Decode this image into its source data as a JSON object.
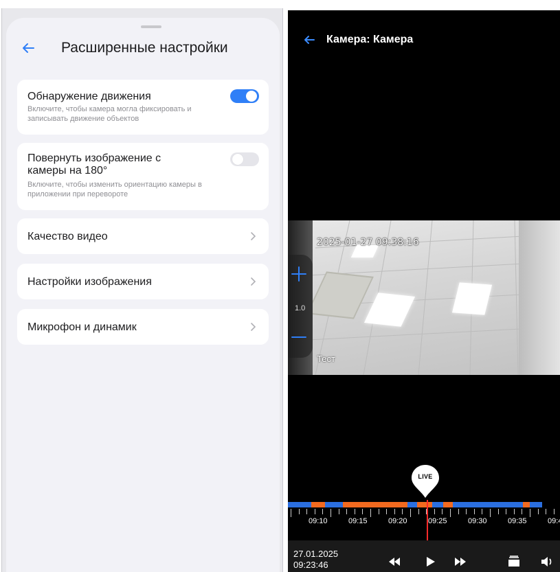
{
  "left": {
    "title": "Расширенные настройки",
    "cards": [
      {
        "title": "Обнаружение движения",
        "desc": "Включите, чтобы камера могла фиксировать и записывать движение объектов",
        "toggle": "on"
      },
      {
        "title": "Повернуть изображение с камеры на 180°",
        "desc": "Включите, чтобы изменить ориентацию камеры в приложении при перевороте",
        "toggle": "off"
      },
      {
        "title": "Качество видео"
      },
      {
        "title": "Настройки изображения"
      },
      {
        "title": "Микрофон и динамик"
      }
    ]
  },
  "right": {
    "title": "Камера: Камера",
    "video": {
      "timestamp": "2025-01-27 09:38:16",
      "camera_label": "Тест",
      "zoom": "1.0"
    },
    "live_label": "LIVE",
    "timeline_labels": [
      "09:10",
      "09:15",
      "09:20",
      "09:25",
      "09:30",
      "09:35",
      "09:4"
    ],
    "date": "27.01.2025",
    "time": "09:23:46"
  },
  "colors": {
    "accent": "#2f7ff7",
    "timeline_blue": "#2b6fe0",
    "timeline_orange": "#f26a1f",
    "cursor_red": "#ff2a2a"
  }
}
